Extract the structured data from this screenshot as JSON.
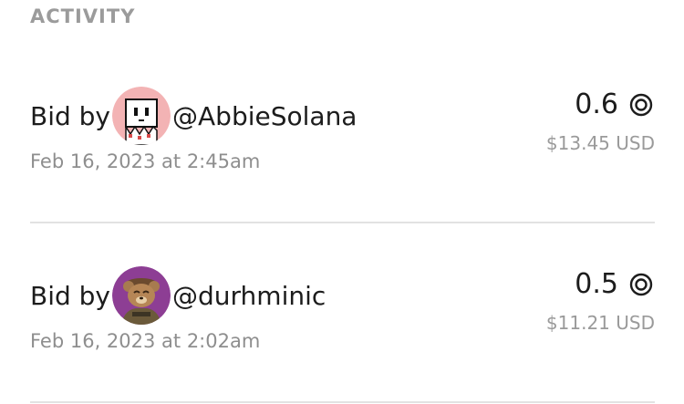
{
  "section": {
    "title": "ACTIVITY"
  },
  "activity": [
    {
      "prefix": "Bid by",
      "user": "@AbbieSolana",
      "timestamp": "Feb 16, 2023 at 2:45am",
      "amount": "0.6",
      "usd": "$13.45 USD",
      "avatar_icon": "ghost-avatar-icon",
      "avatar_bg": "#f3b3b4"
    },
    {
      "prefix": "Bid by",
      "user": "@durhminic",
      "timestamp": "Feb 16, 2023 at 2:02am",
      "amount": "0.5",
      "usd": "$11.21 USD",
      "avatar_icon": "bear-avatar-icon",
      "avatar_bg": "#8d3e94"
    }
  ],
  "colors": {
    "text_primary": "#1c1c1c",
    "text_secondary": "#8e8e8e",
    "divider": "#e2e2e2"
  },
  "currency_icon": "coin-icon"
}
